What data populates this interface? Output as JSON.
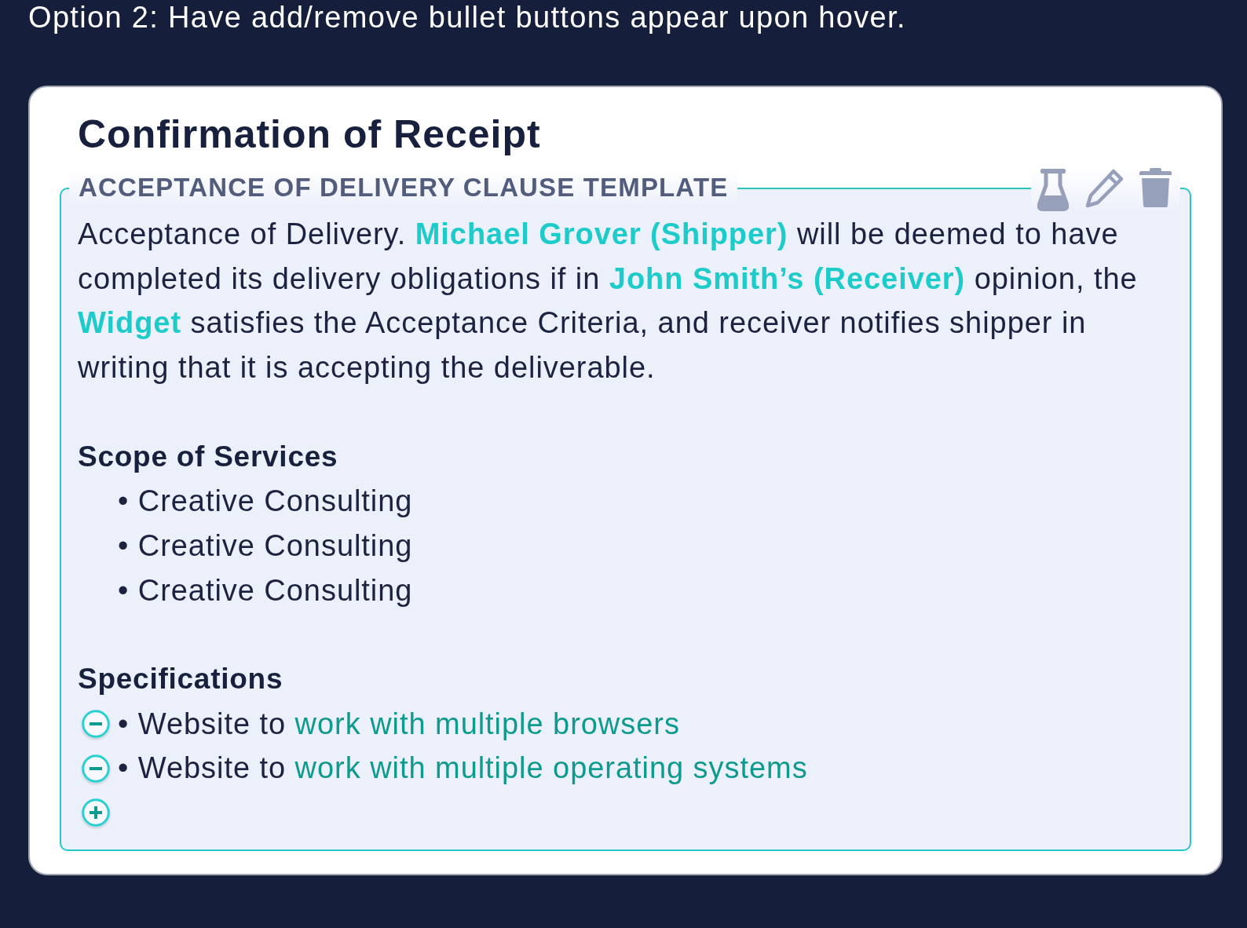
{
  "caption": "Option 2: Have add/remove bullet buttons appear upon hover.",
  "card": {
    "title": "Confirmation of Receipt",
    "clause": {
      "label": "ACCEPTANCE OF DELIVERY CLAUSE TEMPLATE",
      "paragraph": [
        {
          "kind": "plain",
          "text": "Acceptance of Delivery. "
        },
        {
          "kind": "party",
          "text": "Michael Grover (Shipper)"
        },
        {
          "kind": "plain",
          "text": " will be deemed to have completed its delivery obligations if in "
        },
        {
          "kind": "party",
          "text": "John Smith’s (Receiver)"
        },
        {
          "kind": "plain",
          "text": " opinion, the "
        },
        {
          "kind": "party",
          "text": "Widget"
        },
        {
          "kind": "plain",
          "text": " satisfies the Acceptance Criteria, and receiver notifies shipper in writing that it is accepting the deliverable."
        }
      ],
      "sections": [
        {
          "heading": "Scope of Services",
          "editable": false,
          "items": [
            {
              "segments": [
                {
                  "kind": "plain",
                  "text": "• Creative Consulting"
                }
              ]
            },
            {
              "segments": [
                {
                  "kind": "plain",
                  "text": "• Creative Consulting"
                }
              ]
            },
            {
              "segments": [
                {
                  "kind": "plain",
                  "text": "• Creative Consulting"
                }
              ]
            }
          ]
        },
        {
          "heading": "Specifications",
          "editable": true,
          "items": [
            {
              "segments": [
                {
                  "kind": "plain",
                  "text": "• Website to "
                },
                {
                  "kind": "variable",
                  "text": "work with multiple browsers"
                }
              ]
            },
            {
              "segments": [
                {
                  "kind": "plain",
                  "text": "• Website to "
                },
                {
                  "kind": "variable",
                  "text": "work with multiple operating systems"
                }
              ]
            }
          ]
        }
      ]
    }
  }
}
